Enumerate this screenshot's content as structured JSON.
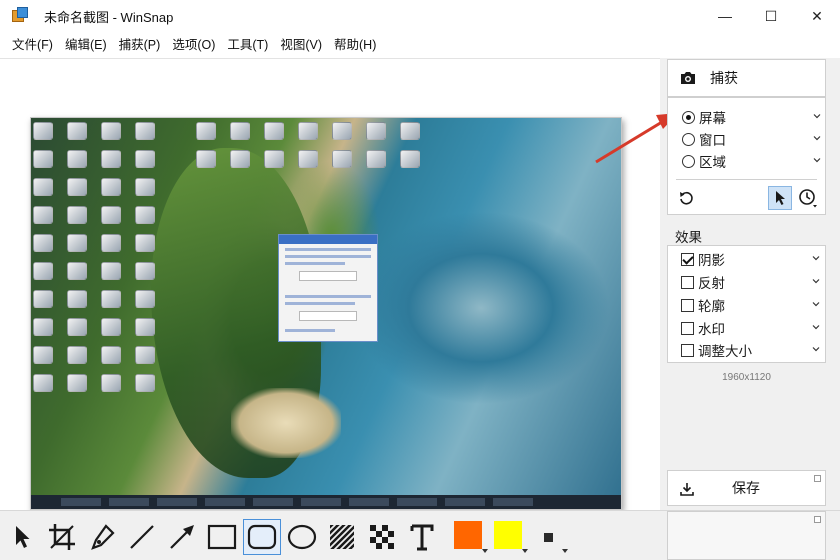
{
  "window": {
    "title": "未命名截图 - WinSnap",
    "minimize_glyph": "—",
    "maximize_glyph": "☐",
    "close_glyph": "✕"
  },
  "menu": [
    "文件(F)",
    "编辑(E)",
    "捕获(P)",
    "选项(O)",
    "工具(T)",
    "视图(V)",
    "帮助(H)"
  ],
  "capture": {
    "label": "捕获",
    "icon": "camera-icon"
  },
  "modes": [
    {
      "label": "屏幕",
      "selected": true
    },
    {
      "label": "窗口",
      "selected": false
    },
    {
      "label": "区域",
      "selected": false
    }
  ],
  "effects": {
    "title": "效果",
    "items": [
      {
        "label": "阴影",
        "checked": true
      },
      {
        "label": "反射",
        "checked": false
      },
      {
        "label": "轮廓",
        "checked": false
      },
      {
        "label": "水印",
        "checked": false
      },
      {
        "label": "调整大小",
        "checked": false
      }
    ]
  },
  "image_size": "1960x1120",
  "save": {
    "label": "保存",
    "icon": "download-icon"
  },
  "tools": [
    "pointer",
    "crop",
    "pen",
    "line",
    "arrow",
    "rectangle",
    "rounded-rectangle",
    "ellipse",
    "hatch",
    "pixelate",
    "text"
  ],
  "selected_tool": "rounded-rectangle",
  "colors": {
    "fill": "#ff6600",
    "outline": "#ffff00",
    "accent_arrow": "#d63a2a",
    "selection": "#4a90d9"
  }
}
